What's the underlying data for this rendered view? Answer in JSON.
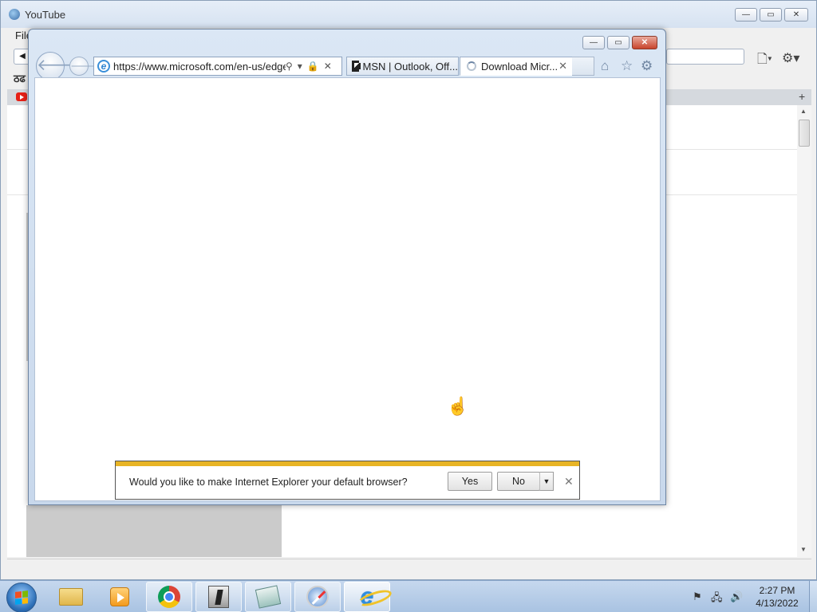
{
  "background_window": {
    "title": "YouTube",
    "menu_first": "File",
    "glyph": "ठढ"
  },
  "caption": {
    "minimize": "—",
    "maximize": "▭",
    "close": "✕"
  },
  "ie": {
    "address": "https://www.microsoft.com/en-us/edge",
    "tabs": [
      {
        "label": "MSN | Outlook, Off...",
        "state": "inactive"
      },
      {
        "label": "Download Micr...",
        "state": "loading"
      }
    ],
    "notification": {
      "message": "Would you like to make Internet Explorer your default browser?",
      "yes_label": "Yes",
      "no_label": "No"
    }
  },
  "taskbar": {
    "items": [
      "windows-explorer",
      "media-center",
      "chrome",
      "counter-strike",
      "notes",
      "safari",
      "internet-explorer"
    ],
    "clock_time": "2:27 PM",
    "clock_date": "4/13/2022"
  },
  "colors": {
    "notification_accent": "#e8b425",
    "ie_close_button": "#c8442c",
    "taskbar": "#b8cde8"
  }
}
